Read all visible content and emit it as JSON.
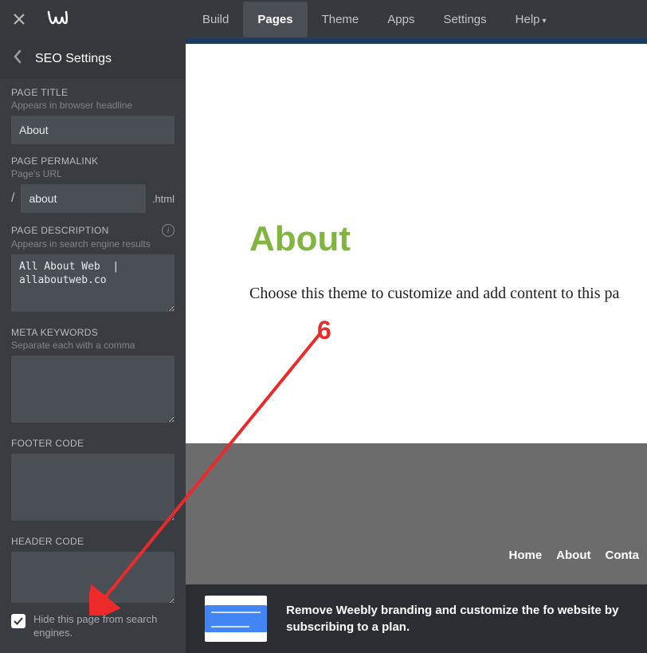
{
  "topnav": {
    "items": [
      "Build",
      "Pages",
      "Theme",
      "Apps",
      "Settings",
      "Help"
    ],
    "active_index": 1
  },
  "sidebar": {
    "title": "SEO Settings",
    "page_title": {
      "label": "PAGE TITLE",
      "hint": "Appears in browser headline",
      "value": "About"
    },
    "permalink": {
      "label": "PAGE PERMALINK",
      "hint": "Page's URL",
      "slash": "/",
      "value": "about",
      "ext": ".html"
    },
    "description": {
      "label": "PAGE DESCRIPTION",
      "hint": "Appears in search engine results",
      "value": "All About Web  | allaboutweb.co"
    },
    "meta": {
      "label": "META KEYWORDS",
      "hint": "Separate each with a comma",
      "value": ""
    },
    "footer_code": {
      "label": "FOOTER CODE",
      "value": ""
    },
    "header_code": {
      "label": "HEADER CODE",
      "value": ""
    },
    "hide_checkbox": {
      "label": "Hide this page from search engines.",
      "checked": true
    }
  },
  "preview": {
    "heading": "About",
    "body_text": "Choose this theme to customize and add content to this pa",
    "footer_nav": [
      "Home",
      "About",
      "Conta"
    ]
  },
  "upgrade": {
    "text": "Remove Weebly branding and customize the fo website by subscribing to a plan."
  },
  "annotation": {
    "number": "6"
  }
}
